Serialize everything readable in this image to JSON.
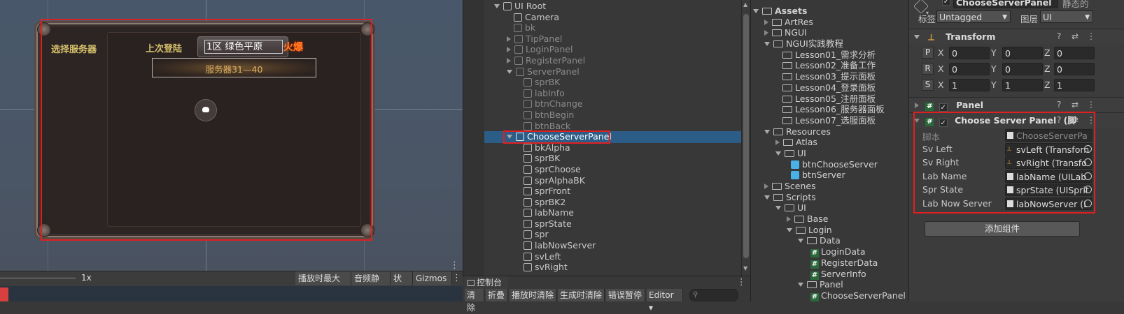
{
  "scene": {
    "left_title": "选择服务器",
    "last_login_label": "上次登陆",
    "last_server_name": "1区  绿色平原",
    "last_server_state": "火爆",
    "server_range": "服务器31—40",
    "toolbar": {
      "scale": "1x",
      "maximize": "播放时最大化",
      "mute": "音频静音",
      "stats": "状态",
      "gizmos": "Gizmos"
    }
  },
  "hierarchy": {
    "items": [
      {
        "label": "UI Root",
        "dim": false
      },
      {
        "label": "Camera",
        "dim": false
      },
      {
        "label": "bk",
        "dim": true
      },
      {
        "label": "TipPanel",
        "dim": true
      },
      {
        "label": "LoginPanel",
        "dim": true
      },
      {
        "label": "RegisterPanel",
        "dim": true
      },
      {
        "label": "ServerPanel",
        "dim": true
      },
      {
        "label": "sprBK",
        "dim": true
      },
      {
        "label": "labInfo",
        "dim": true
      },
      {
        "label": "btnChange",
        "dim": true
      },
      {
        "label": "btnBegin",
        "dim": true
      },
      {
        "label": "btnBack",
        "dim": true
      },
      {
        "label": "ChooseServerPanel",
        "dim": false
      },
      {
        "label": "bkAlpha",
        "dim": false
      },
      {
        "label": "sprBK",
        "dim": false
      },
      {
        "label": "sprChoose",
        "dim": false
      },
      {
        "label": "sprAlphaBK",
        "dim": false
      },
      {
        "label": "sprFront",
        "dim": false
      },
      {
        "label": "sprBK2",
        "dim": false
      },
      {
        "label": "labName",
        "dim": false
      },
      {
        "label": "sprState",
        "dim": false
      },
      {
        "label": "spr",
        "dim": false
      },
      {
        "label": "labNowServer",
        "dim": false
      },
      {
        "label": "svLeft",
        "dim": false
      },
      {
        "label": "svRight",
        "dim": false
      }
    ]
  },
  "console": {
    "tab": "控制台",
    "buttons": [
      "清除",
      "折叠",
      "播放时清除",
      "生成时清除",
      "错误暂停",
      "Editor ▾"
    ]
  },
  "project": {
    "items": [
      {
        "label": "Assets",
        "type": "folder-open"
      },
      {
        "label": "ArtRes",
        "type": "folder"
      },
      {
        "label": "NGUI",
        "type": "folder"
      },
      {
        "label": "NGUI实践教程",
        "type": "folder-open"
      },
      {
        "label": "Lesson01_需求分析",
        "type": "folder"
      },
      {
        "label": "Lesson02_准备工作",
        "type": "folder"
      },
      {
        "label": "Lesson03_提示面板",
        "type": "folder"
      },
      {
        "label": "Lesson04_登录面板",
        "type": "folder"
      },
      {
        "label": "Lesson05_注册面板",
        "type": "folder"
      },
      {
        "label": "Lesson06_服务器面板",
        "type": "folder"
      },
      {
        "label": "Lesson07_选服面板",
        "type": "folder"
      },
      {
        "label": "Resources",
        "type": "folder-open"
      },
      {
        "label": "Atlas",
        "type": "folder"
      },
      {
        "label": "UI",
        "type": "folder-open"
      },
      {
        "label": "btnChooseServer",
        "type": "prefab"
      },
      {
        "label": "btnServer",
        "type": "prefab"
      },
      {
        "label": "Scenes",
        "type": "folder"
      },
      {
        "label": "Scripts",
        "type": "folder-open"
      },
      {
        "label": "UI",
        "type": "folder-open"
      },
      {
        "label": "Base",
        "type": "folder"
      },
      {
        "label": "Login",
        "type": "folder-open"
      },
      {
        "label": "Data",
        "type": "folder-open"
      },
      {
        "label": "LoginData",
        "type": "script"
      },
      {
        "label": "RegisterData",
        "type": "script"
      },
      {
        "label": "ServerInfo",
        "type": "script"
      },
      {
        "label": "Panel",
        "type": "folder-open"
      },
      {
        "label": "ChooseServerPanel",
        "type": "script"
      }
    ]
  },
  "inspector": {
    "object_name": "ChooseServerPanel",
    "static_label": "静态的",
    "tag_label": "标签",
    "tag_value": "Untagged",
    "layer_label": "图层",
    "layer_value": "UI",
    "transform": {
      "title": "Transform",
      "rows": [
        {
          "key": "P",
          "x": "0",
          "y": "0",
          "z": "0"
        },
        {
          "key": "R",
          "x": "0",
          "y": "0",
          "z": "0"
        },
        {
          "key": "S",
          "x": "1",
          "y": "1",
          "z": "1"
        }
      ]
    },
    "panel_title": "Panel",
    "script_title": "Choose Server Panel",
    "script_suffix": "(脚",
    "fields": [
      {
        "label": "脚本",
        "value": "ChooseServerPa"
      },
      {
        "label": "Sv Left",
        "value": "svLeft (Transforn"
      },
      {
        "label": "Sv Right",
        "value": "svRight (Transfo"
      },
      {
        "label": "Lab Name",
        "value": "labName (UILab"
      },
      {
        "label": "Spr State",
        "value": "sprState (UISprit"
      },
      {
        "label": "Lab Now Server",
        "value": "labNowServer (L"
      }
    ],
    "add_component": "添加组件"
  }
}
